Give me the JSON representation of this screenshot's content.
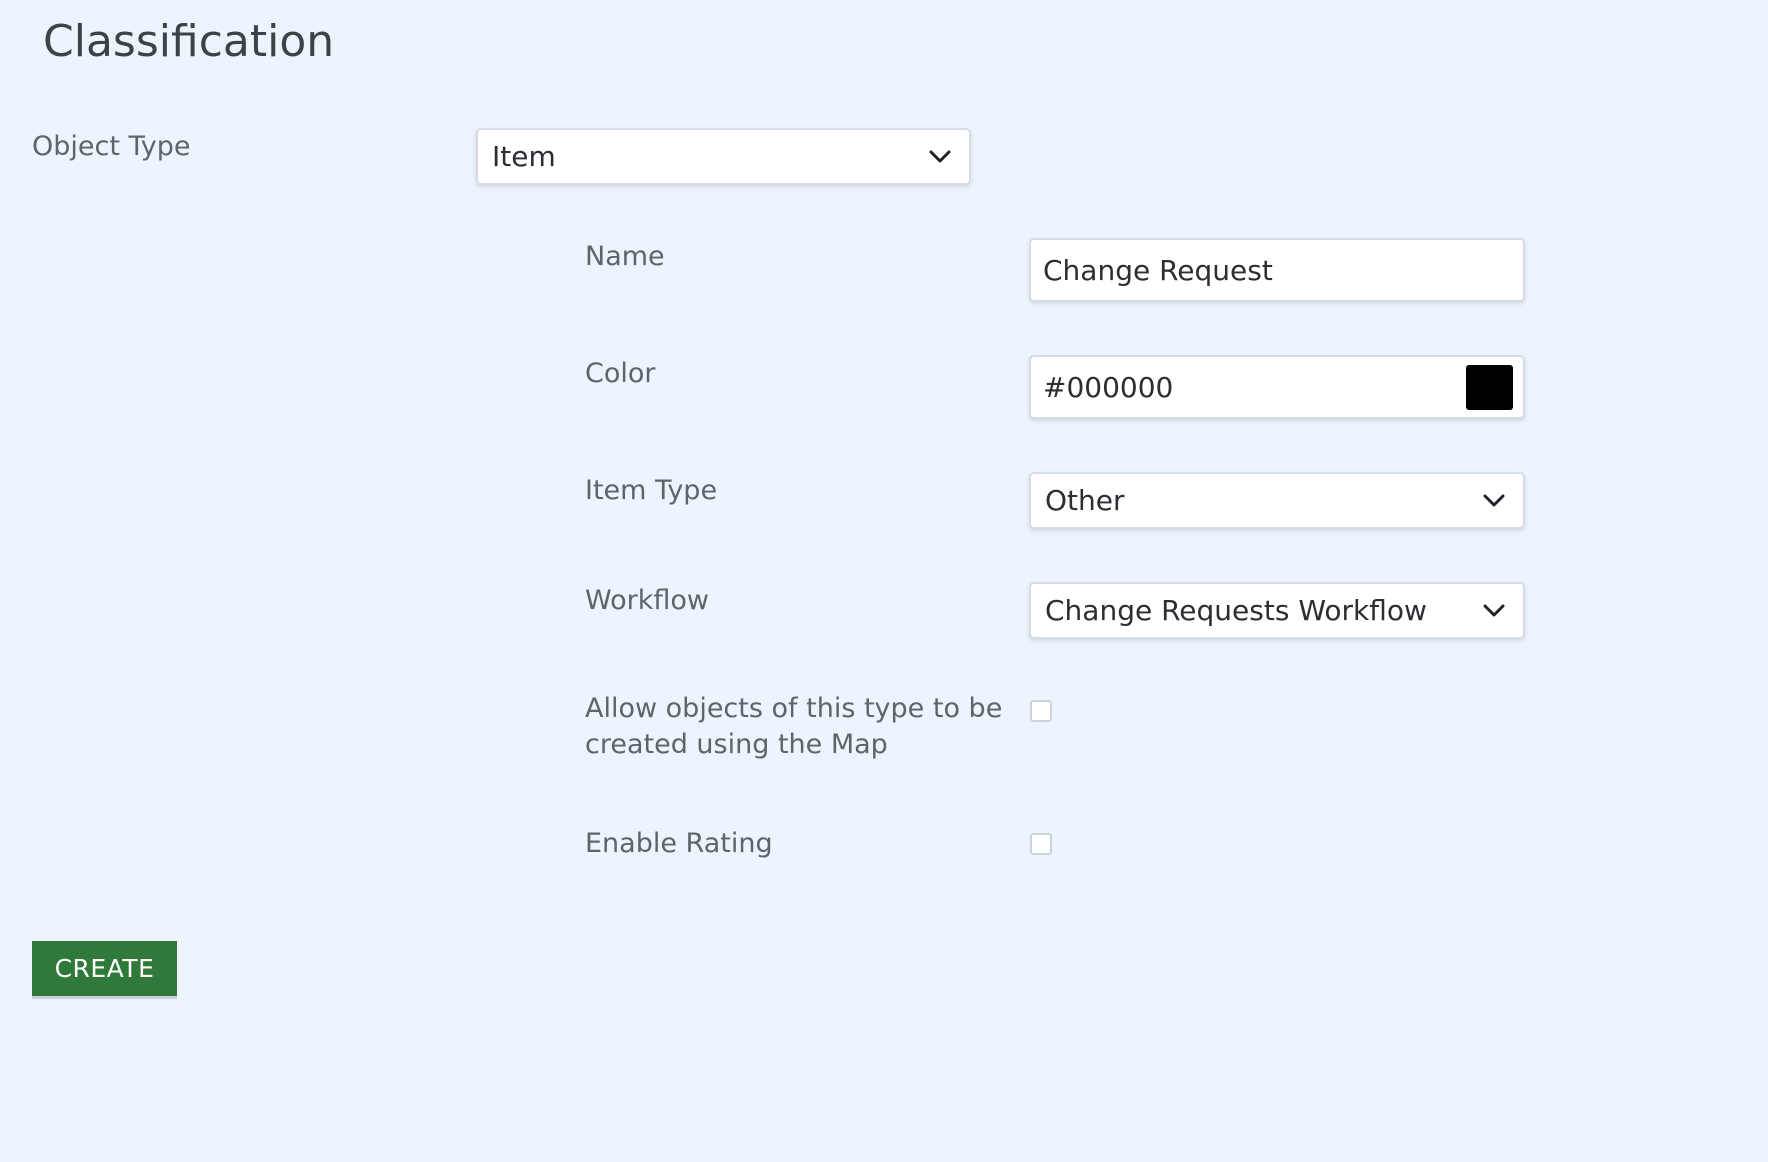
{
  "page": {
    "title": "Classification"
  },
  "form": {
    "object_type": {
      "label": "Object Type",
      "value": "Item"
    },
    "name": {
      "label": "Name",
      "value": "Change Request"
    },
    "color": {
      "label": "Color",
      "value": "#000000",
      "swatch_color": "#000000"
    },
    "item_type": {
      "label": "Item Type",
      "value": "Other"
    },
    "workflow": {
      "label": "Workflow",
      "value": "Change Requests Workflow"
    },
    "allow_map": {
      "label_line1": "Allow objects of this type to be",
      "label_line2": "created using the Map",
      "checked": false
    },
    "enable_rating": {
      "label": "Enable Rating",
      "checked": false
    }
  },
  "actions": {
    "create_label": "CREATE"
  },
  "icons": {
    "dropdown": "chevron-down-icon"
  },
  "colors": {
    "background": "#eef4fe",
    "primary_button": "#2f7a3b"
  }
}
